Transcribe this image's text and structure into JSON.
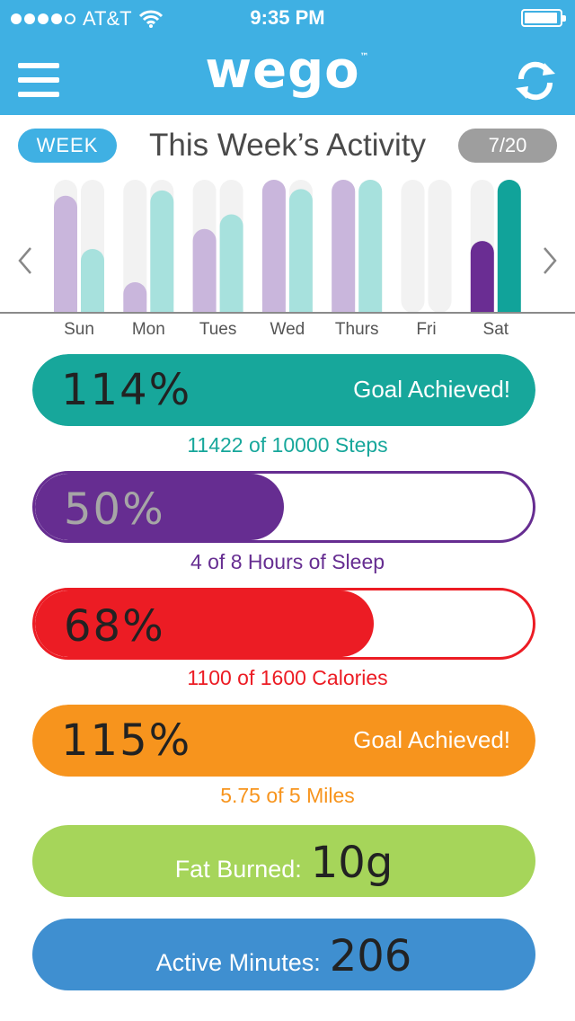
{
  "status_bar": {
    "carrier": "AT&T",
    "time": "9:35 PM"
  },
  "header": {
    "logo_text": "wego",
    "logo_mark": "™",
    "menu_icon": "hamburger-menu-icon",
    "sync_icon": "sync-icon"
  },
  "week": {
    "period_label": "WEEK",
    "title": "This Week’s Activity",
    "date": "7/20"
  },
  "chart_data": {
    "type": "bar",
    "categories": [
      "Sun",
      "Mon",
      "Tues",
      "Wed",
      "Thurs",
      "Fri",
      "Sat"
    ],
    "series": [
      {
        "values": [
          0.88,
          0.23,
          0.63,
          1.0,
          1.0,
          0.0,
          0.54
        ],
        "color": "#c9b6dc",
        "highlight_color": "#6a2d93"
      },
      {
        "values": [
          0.48,
          0.92,
          0.74,
          0.93,
          1.0,
          0.0,
          1.0
        ],
        "color": "#a7e1dd",
        "highlight_color": "#11a39a"
      }
    ],
    "highlighted_category": "Sat",
    "track_color": "#f2f2f2"
  },
  "stats": [
    {
      "percent": "114%",
      "fraction": 1.0,
      "achieved": "Goal Achieved!",
      "caption": "11422 of 10000 Steps",
      "color": "#17a79b",
      "text_color": "#222222"
    },
    {
      "percent": "50%",
      "fraction": 0.5,
      "achieved": "",
      "caption": "4 of 8 Hours of Sleep",
      "color": "#662d91",
      "text_color": "#a6a6a6"
    },
    {
      "percent": "68%",
      "fraction": 0.68,
      "achieved": "",
      "caption": "1100 of 1600 Calories",
      "color": "#ec1c24",
      "text_color": "#222222"
    },
    {
      "percent": "115%",
      "fraction": 1.0,
      "achieved": "Goal Achieved!",
      "caption": "5.75 of 5 Miles",
      "color": "#f7941d",
      "text_color": "#222222"
    }
  ],
  "metrics": [
    {
      "label": "Fat Burned:",
      "value": "10g",
      "color": "#a6d55a"
    },
    {
      "label": "Active Minutes:",
      "value": "206",
      "color": "#3f8fd0"
    }
  ]
}
